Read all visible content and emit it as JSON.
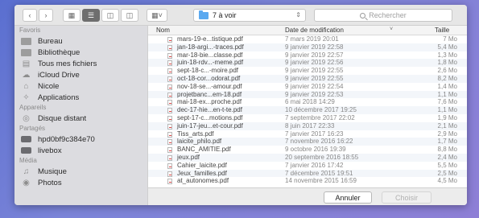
{
  "toolbar": {
    "folder": "7 à voir",
    "search_placeholder": "Rechercher"
  },
  "sidebar": {
    "sections": [
      {
        "title": "Favoris",
        "items": [
          "Bureau",
          "Bibliothèque",
          "Tous mes fichiers",
          "iCloud Drive",
          "Nicole",
          "Applications"
        ]
      },
      {
        "title": "Appareils",
        "items": [
          "Disque distant"
        ]
      },
      {
        "title": "Partagés",
        "items": [
          "hpd0bf9c384e70",
          "livebox"
        ]
      },
      {
        "title": "Média",
        "items": [
          "Musique",
          "Photos"
        ]
      }
    ]
  },
  "columns": {
    "name": "Nom",
    "date": "Date de modification",
    "size": "Taille"
  },
  "files": [
    {
      "name": "mars-19-e...tistique.pdf",
      "date": "7 mars 2019 20:01",
      "size": "7 Mo"
    },
    {
      "name": "jan-18-argi...-traces.pdf",
      "date": "9 janvier 2019 22:58",
      "size": "5,4 Mo"
    },
    {
      "name": "mar-18-bie...classe.pdf",
      "date": "9 janvier 2019 22:57",
      "size": "1,3 Mo"
    },
    {
      "name": "juin-18-rdv...-meme.pdf",
      "date": "9 janvier 2019 22:56",
      "size": "1,8 Mo"
    },
    {
      "name": "sept-18-c...-moire.pdf",
      "date": "9 janvier 2019 22:55",
      "size": "2,6 Mo"
    },
    {
      "name": "oct-18-cor...odorat.pdf",
      "date": "9 janvier 2019 22:55",
      "size": "8,2 Mo"
    },
    {
      "name": "nov-18-se...-amour.pdf",
      "date": "9 janvier 2019 22:54",
      "size": "1,4 Mo"
    },
    {
      "name": "projetbanc...em-18.pdf",
      "date": "9 janvier 2019 22:53",
      "size": "1,1 Mo"
    },
    {
      "name": "mai-18-ex...proche.pdf",
      "date": "6 mai 2018 14:29",
      "size": "7,6 Mo"
    },
    {
      "name": "dec-17-hie...en-t-te.pdf",
      "date": "10 décembre 2017 19:25",
      "size": "1,1 Mo"
    },
    {
      "name": "sept-17-c...motions.pdf",
      "date": "7 septembre 2017 22:02",
      "size": "1,9 Mo"
    },
    {
      "name": "juin-17-jeu...et-cour.pdf",
      "date": "8 juin 2017 22:33",
      "size": "2,1 Mo"
    },
    {
      "name": "Tiss_arts.pdf",
      "date": "7 janvier 2017 16:23",
      "size": "2,9 Mo"
    },
    {
      "name": "laicite_philo.pdf",
      "date": "7 novembre 2016 16:22",
      "size": "1,7 Mo"
    },
    {
      "name": "BANC_AMITIE.pdf",
      "date": "9 octobre 2016 19:39",
      "size": "8,8 Mo"
    },
    {
      "name": "jeux.pdf",
      "date": "20 septembre 2016 18:55",
      "size": "2,4 Mo"
    },
    {
      "name": "Cahier_laicite.pdf",
      "date": "7 janvier 2016 17:42",
      "size": "5,5 Mo"
    },
    {
      "name": "Jeux_familles.pdf",
      "date": "7 décembre 2015 19:51",
      "size": "2,5 Mo"
    },
    {
      "name": "at_autonomes.pdf",
      "date": "14 novembre 2015 16:59",
      "size": "4,5 Mo"
    }
  ],
  "buttons": {
    "cancel": "Annuler",
    "choose": "Choisir"
  }
}
